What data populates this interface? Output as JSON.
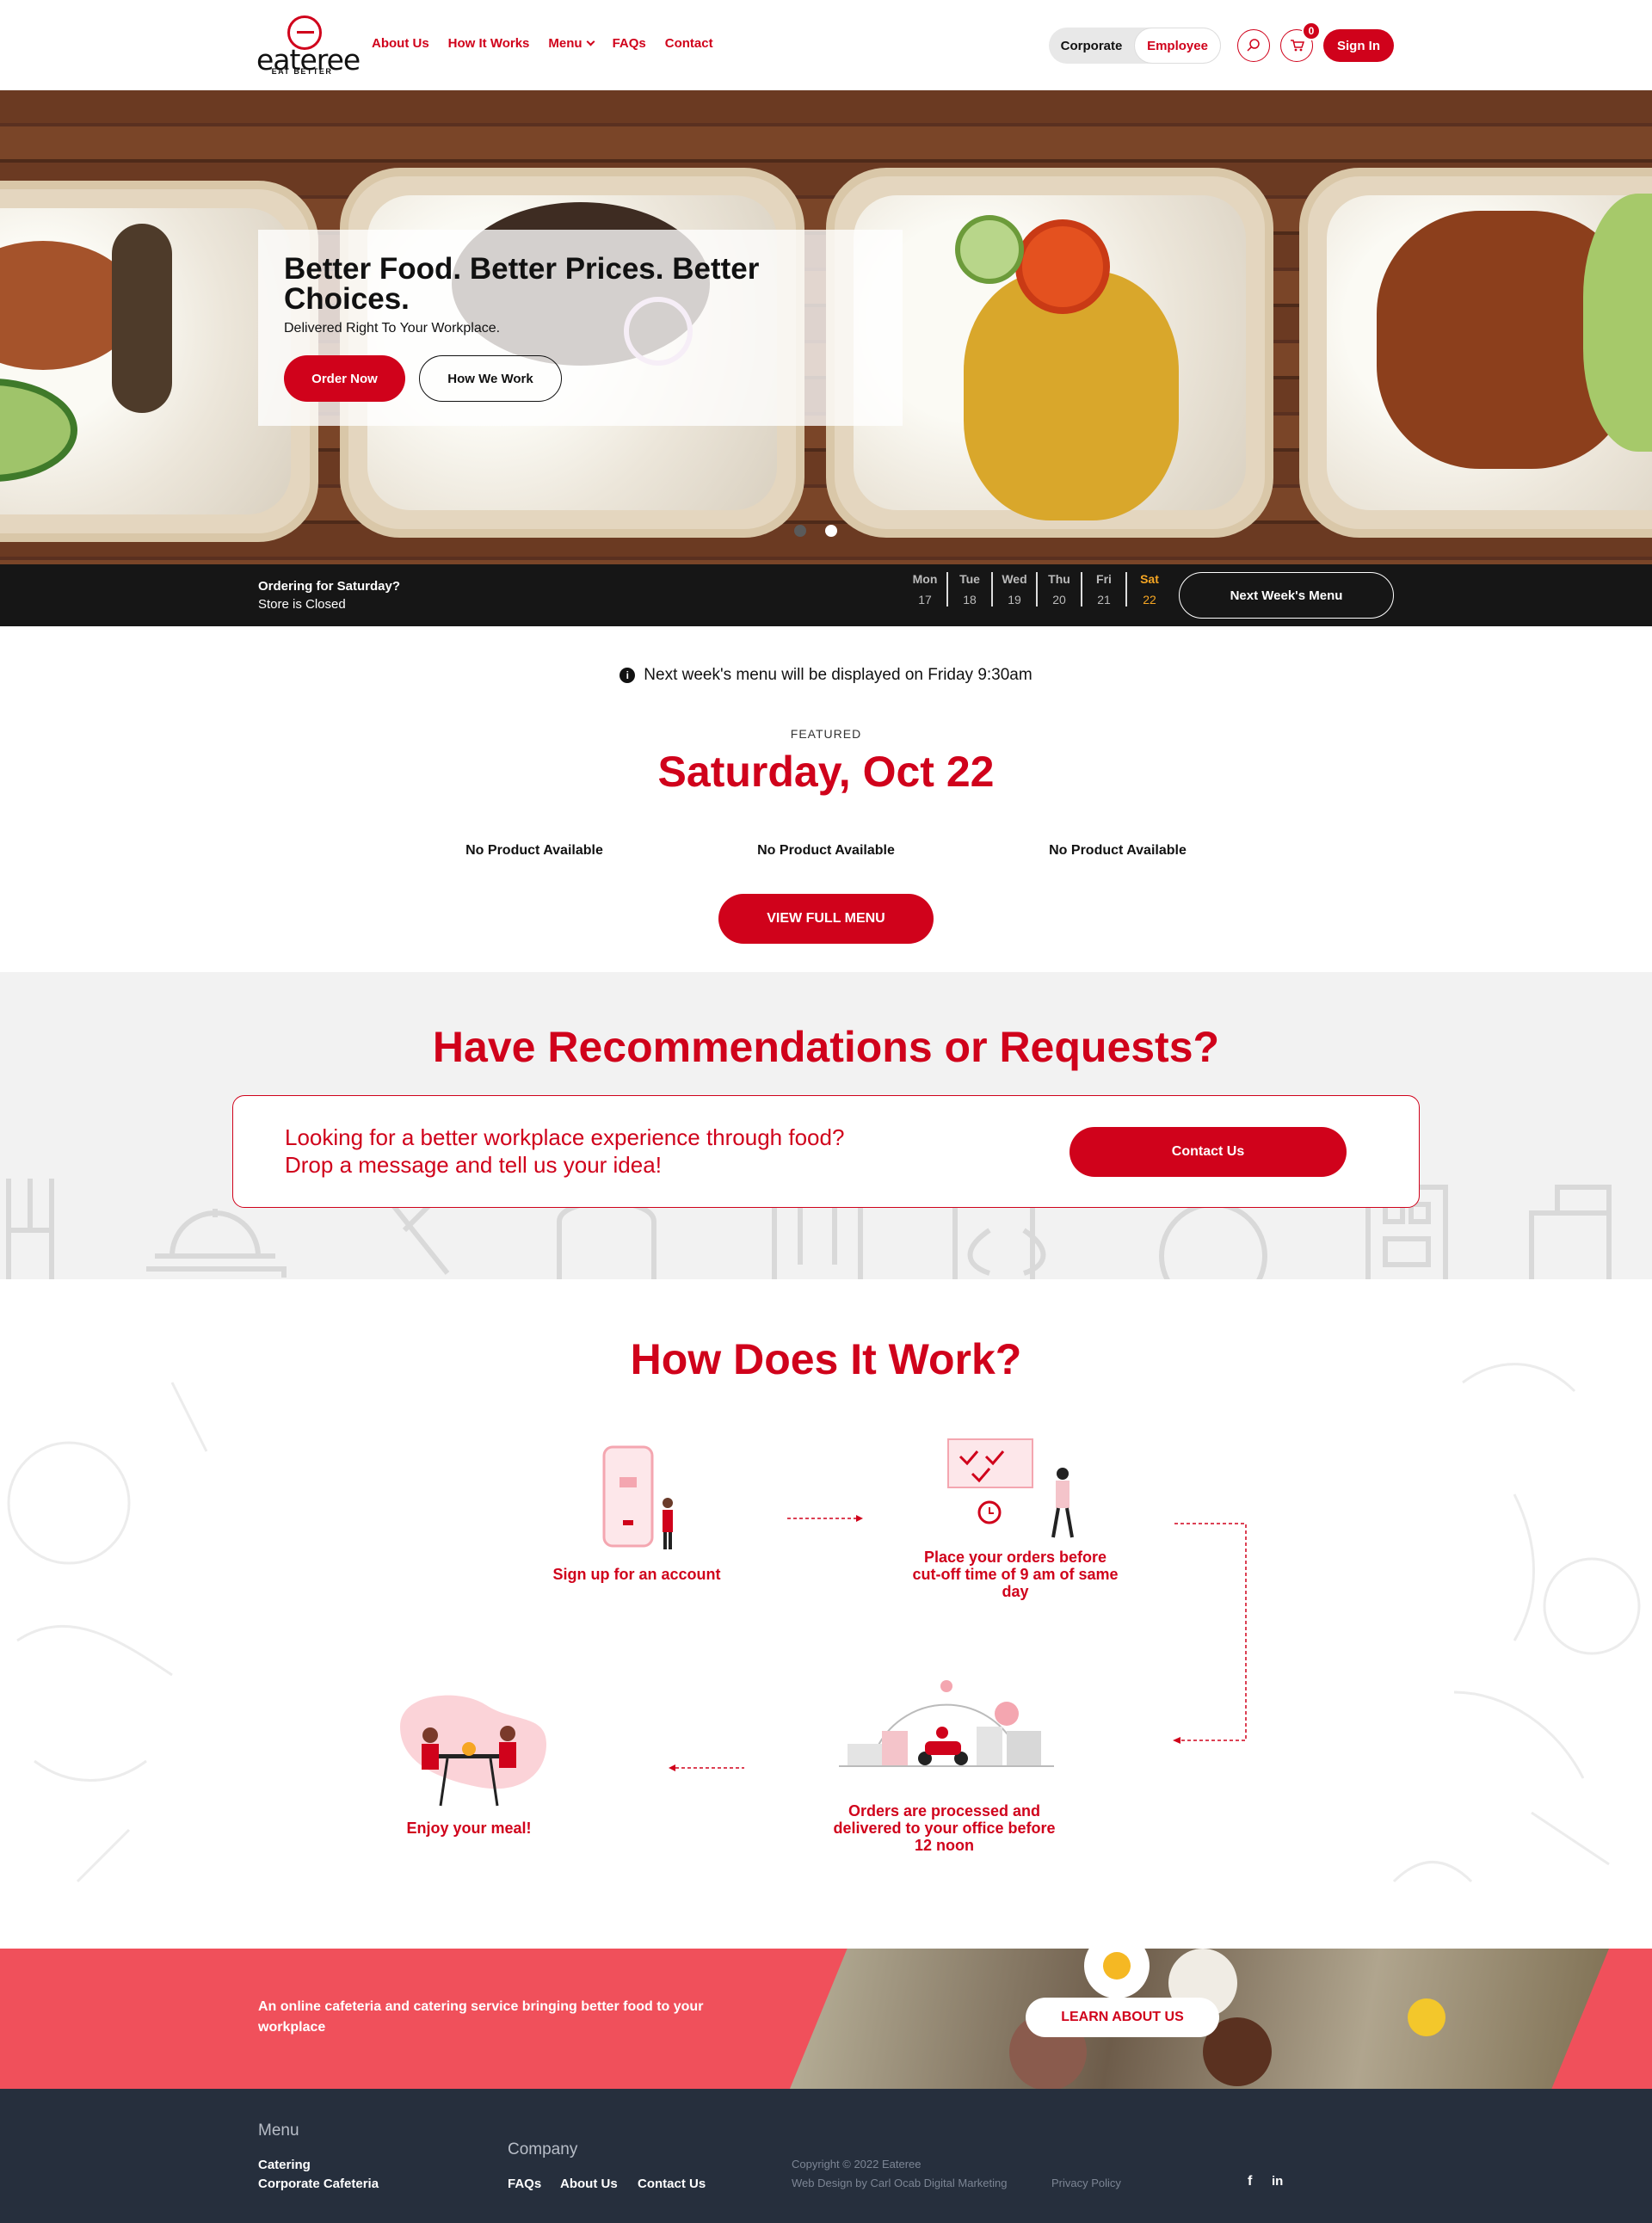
{
  "brand": {
    "name": "eateree",
    "tagline": "EAT BETTER"
  },
  "nav": {
    "items": [
      {
        "label": "About Us"
      },
      {
        "label": "How It Works"
      },
      {
        "label": "Menu"
      },
      {
        "label": "FAQs"
      },
      {
        "label": "Contact"
      }
    ]
  },
  "toggle": {
    "corporate": "Corporate",
    "employee": "Employee"
  },
  "cart": {
    "count": "0"
  },
  "signin": "Sign In",
  "hero": {
    "title": "Better Food. Better Prices. Better Choices.",
    "subtitle": "Delivered Right To Your Workplace.",
    "order_btn": "Order Now",
    "how_btn": "How We Work"
  },
  "orderbar": {
    "title": "Ordering for Saturday?",
    "status": "Store is Closed",
    "days": [
      {
        "name": "Mon",
        "date": "17"
      },
      {
        "name": "Tue",
        "date": "18"
      },
      {
        "name": "Wed",
        "date": "19"
      },
      {
        "name": "Thu",
        "date": "20"
      },
      {
        "name": "Fri",
        "date": "21"
      },
      {
        "name": "Sat",
        "date": "22"
      }
    ],
    "next_btn": "Next Week's Menu"
  },
  "featured": {
    "notice": "Next week's menu will be displayed on Friday 9:30am",
    "label": "FEATURED",
    "date": "Saturday, Oct 22",
    "products": [
      "No Product Available",
      "No Product Available",
      "No Product Available"
    ],
    "menu_btn": "VIEW FULL MENU"
  },
  "recommend": {
    "title": "Have Recommendations or Requests?",
    "line1": "Looking for a better workplace experience through food?",
    "line2": "Drop a message and tell us your idea!",
    "contact_btn": "Contact Us"
  },
  "how": {
    "title": "How Does It Work?",
    "steps": [
      "Sign up for an account",
      "Place your orders before cut-off time of 9 am of same day",
      "Orders are processed and delivered to your office before 12 noon",
      "Enjoy your meal!"
    ]
  },
  "about": {
    "text": "An online cafeteria and catering service bringing better food to your workplace",
    "btn": "LEARN ABOUT US"
  },
  "footer": {
    "menu_head": "Menu",
    "menu_links": [
      "Catering",
      "Corporate Cafeteria"
    ],
    "company_head": "Company",
    "company_links": [
      "FAQs",
      "About Us",
      "Contact Us"
    ],
    "copyright": "Copyright © 2022 Eateree",
    "credit": "Web Design by Carl Ocab Digital Marketing",
    "privacy": "Privacy Policy",
    "social": [
      "f",
      "in"
    ]
  },
  "colors": {
    "brand_red": "#d0021b",
    "banner_red": "#f0505b",
    "footer_bg": "#262f3d",
    "accent_orange": "#f6a623"
  }
}
